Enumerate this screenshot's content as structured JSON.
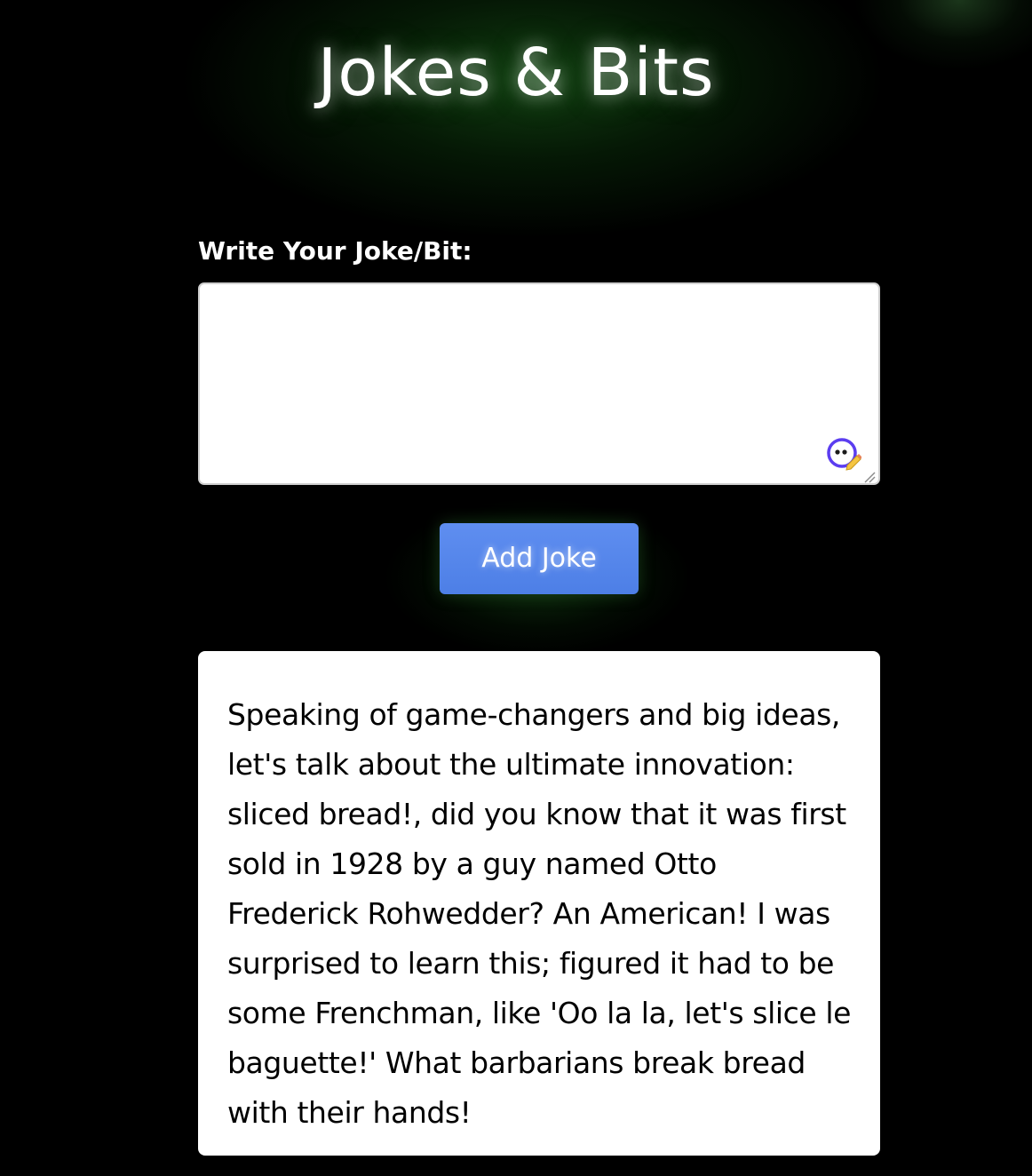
{
  "header": {
    "title": "Jokes & Bits"
  },
  "form": {
    "label": "Write Your Joke/Bit:",
    "input_value": "",
    "assist_icon": "writing-assistant-icon",
    "resize_icon": "resize-handle-icon",
    "add_button_label": "Add Joke",
    "accent_color": "#5b8af0"
  },
  "jokes": [
    {
      "text": "Speaking of game-changers and big ideas, let's talk about the ultimate innovation: sliced bread!, did you know that it was first sold in 1928 by a guy named Otto Frederick Rohwedder? An American! I was surprised to learn this; figured it had to be some Frenchman, like 'Oo la la, let's slice le baguette!' What barbarians break bread with their hands!"
    }
  ],
  "theme": {
    "background": "#000000",
    "glow": "#1e6e1e",
    "card": "#ffffff"
  }
}
